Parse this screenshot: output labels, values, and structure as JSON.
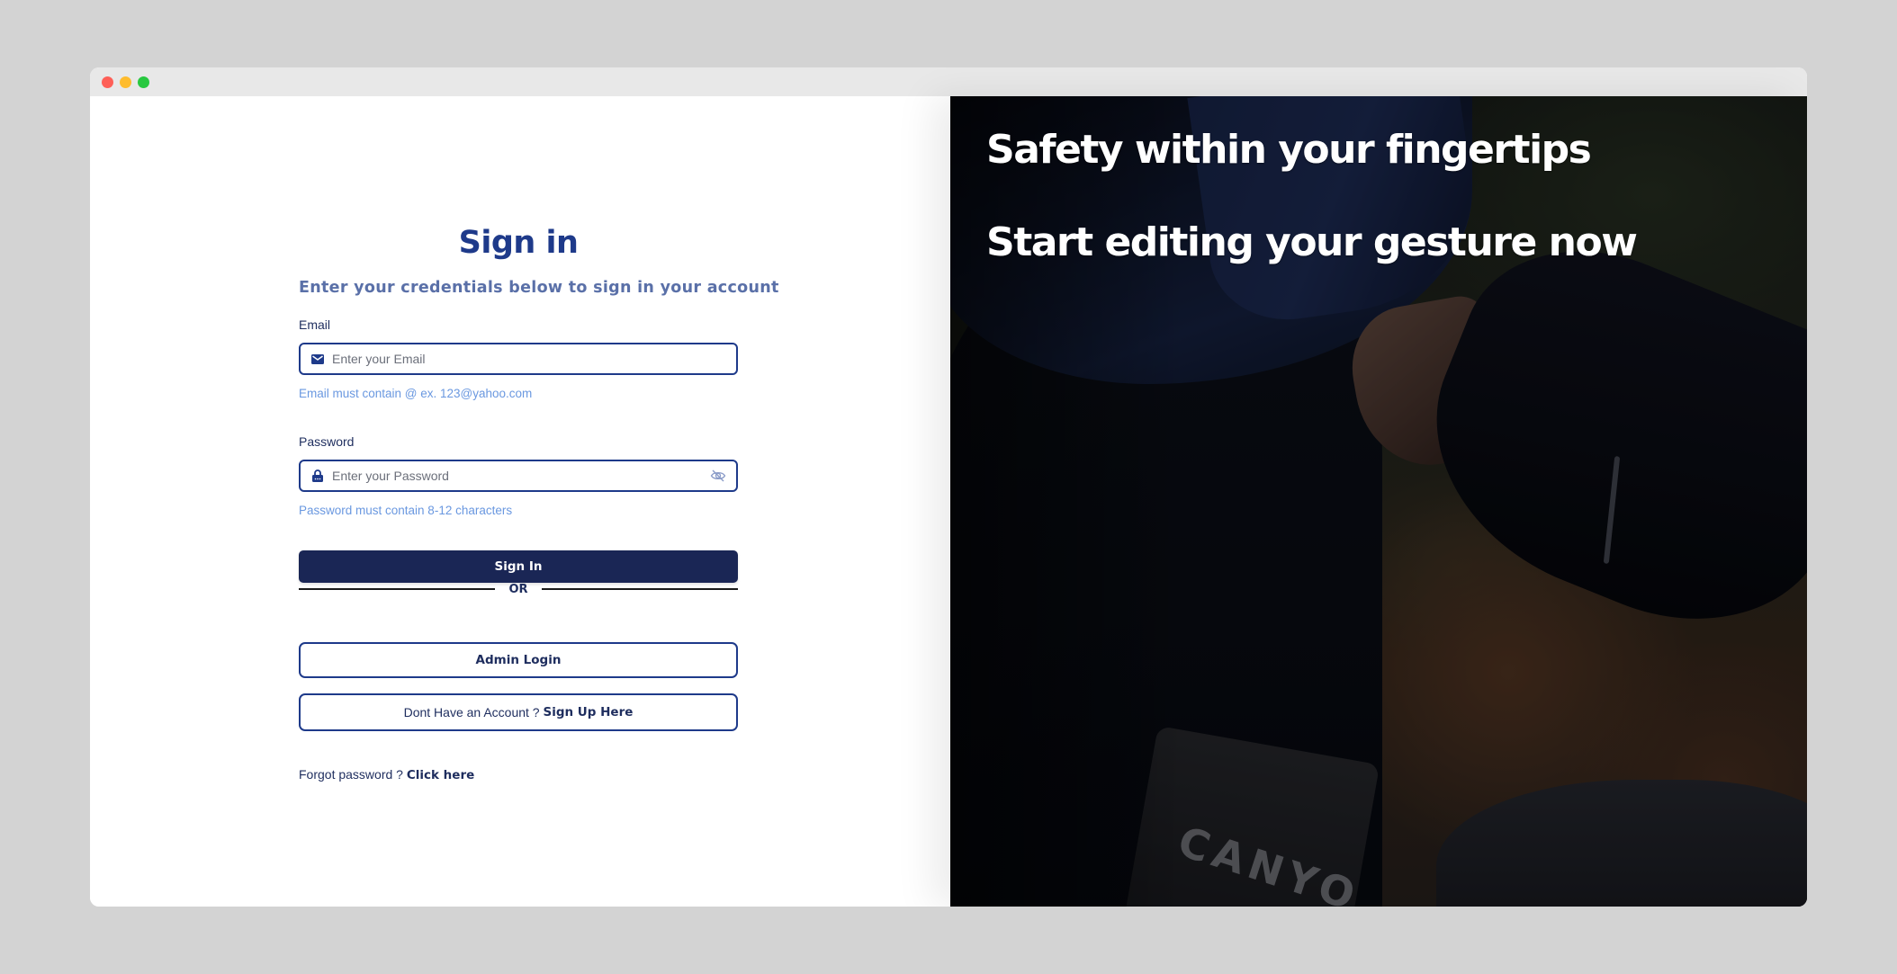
{
  "window": {
    "controls": [
      "close",
      "minimize",
      "maximize"
    ]
  },
  "signin": {
    "title": "Sign in",
    "subtitle": "Enter your credentials below to sign in your account",
    "email": {
      "label": "Email",
      "placeholder": "Enter your Email",
      "value": "",
      "icon": "envelope-icon",
      "hint": "Email must contain @ ex. 123@yahoo.com"
    },
    "password": {
      "label": "Password",
      "placeholder": "Enter your Password",
      "value": "",
      "icon": "lock-icon",
      "toggle_icon": "eye-slash-icon",
      "hint": "Password must contain 8-12 characters"
    },
    "submit_label": "Sign In",
    "divider_label": "OR",
    "admin_label": "Admin Login",
    "signup_prefix": "Dont Have an Account ? ",
    "signup_link": "Sign Up Here",
    "forgot_prefix": "Forgot password ? ",
    "forgot_link": "Click here"
  },
  "hero": {
    "line1": "Safety within your fingertips",
    "line2": "Start editing your gesture now",
    "stem_text": "CANYO"
  },
  "colors": {
    "primary": "#1a2655",
    "accent": "#1e3a8a",
    "hint": "#6a98e0",
    "subtitle": "#5a70a8"
  }
}
